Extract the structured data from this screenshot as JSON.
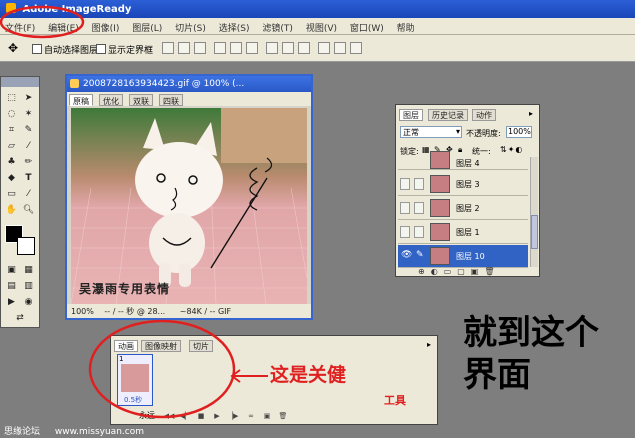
{
  "app_title": "Adobe ImageReady",
  "menu": [
    "文件(F)",
    "编辑(E)",
    "图像(I)",
    "图层(L)",
    "切片(S)",
    "选择(S)",
    "滤镜(T)",
    "视图(V)",
    "窗口(W)",
    "帮助"
  ],
  "options_bar": {
    "auto_select_layer": "自动选择图层",
    "show_bounding_box": "显示定界框"
  },
  "image_window": {
    "title": "2008728163934423.gif @ 100% (...",
    "tabs": [
      "原稿",
      "优化",
      "双联",
      "四联"
    ],
    "status_zoom": "100%",
    "status_time": "-- / -- 秒 @ 28...",
    "status_size": "~84K / -- GIF",
    "photo_caption": "吴瀑雨专用表情"
  },
  "layers_panel": {
    "tabs": [
      "图层",
      "历史记录",
      "动作"
    ],
    "blend_mode": "正常",
    "opacity_label": "不透明度:",
    "opacity_value": "100%",
    "lock_label": "锁定:",
    "unify_label": "统一:",
    "rows": [
      {
        "name": "图层 4",
        "selected": false
      },
      {
        "name": "图层 3",
        "selected": false
      },
      {
        "name": "图层 2",
        "selected": false
      },
      {
        "name": "图层 1",
        "selected": false
      },
      {
        "name": "图层 10",
        "selected": true
      }
    ]
  },
  "animation_panel": {
    "tabs": [
      "动画",
      "图像映射",
      "切片"
    ],
    "frame_number": "1",
    "frame_delay": "0.5秒",
    "loop": "永远"
  },
  "annotations": {
    "right_note": "就到这个界面",
    "arrow_note": "这是关健",
    "arrow_sub": "工具"
  },
  "footer": {
    "left": "思缘论坛",
    "url": "www.missyuan.com"
  },
  "colors": {
    "title_blue": "#2a58c6",
    "highlight_red": "#e02020"
  }
}
